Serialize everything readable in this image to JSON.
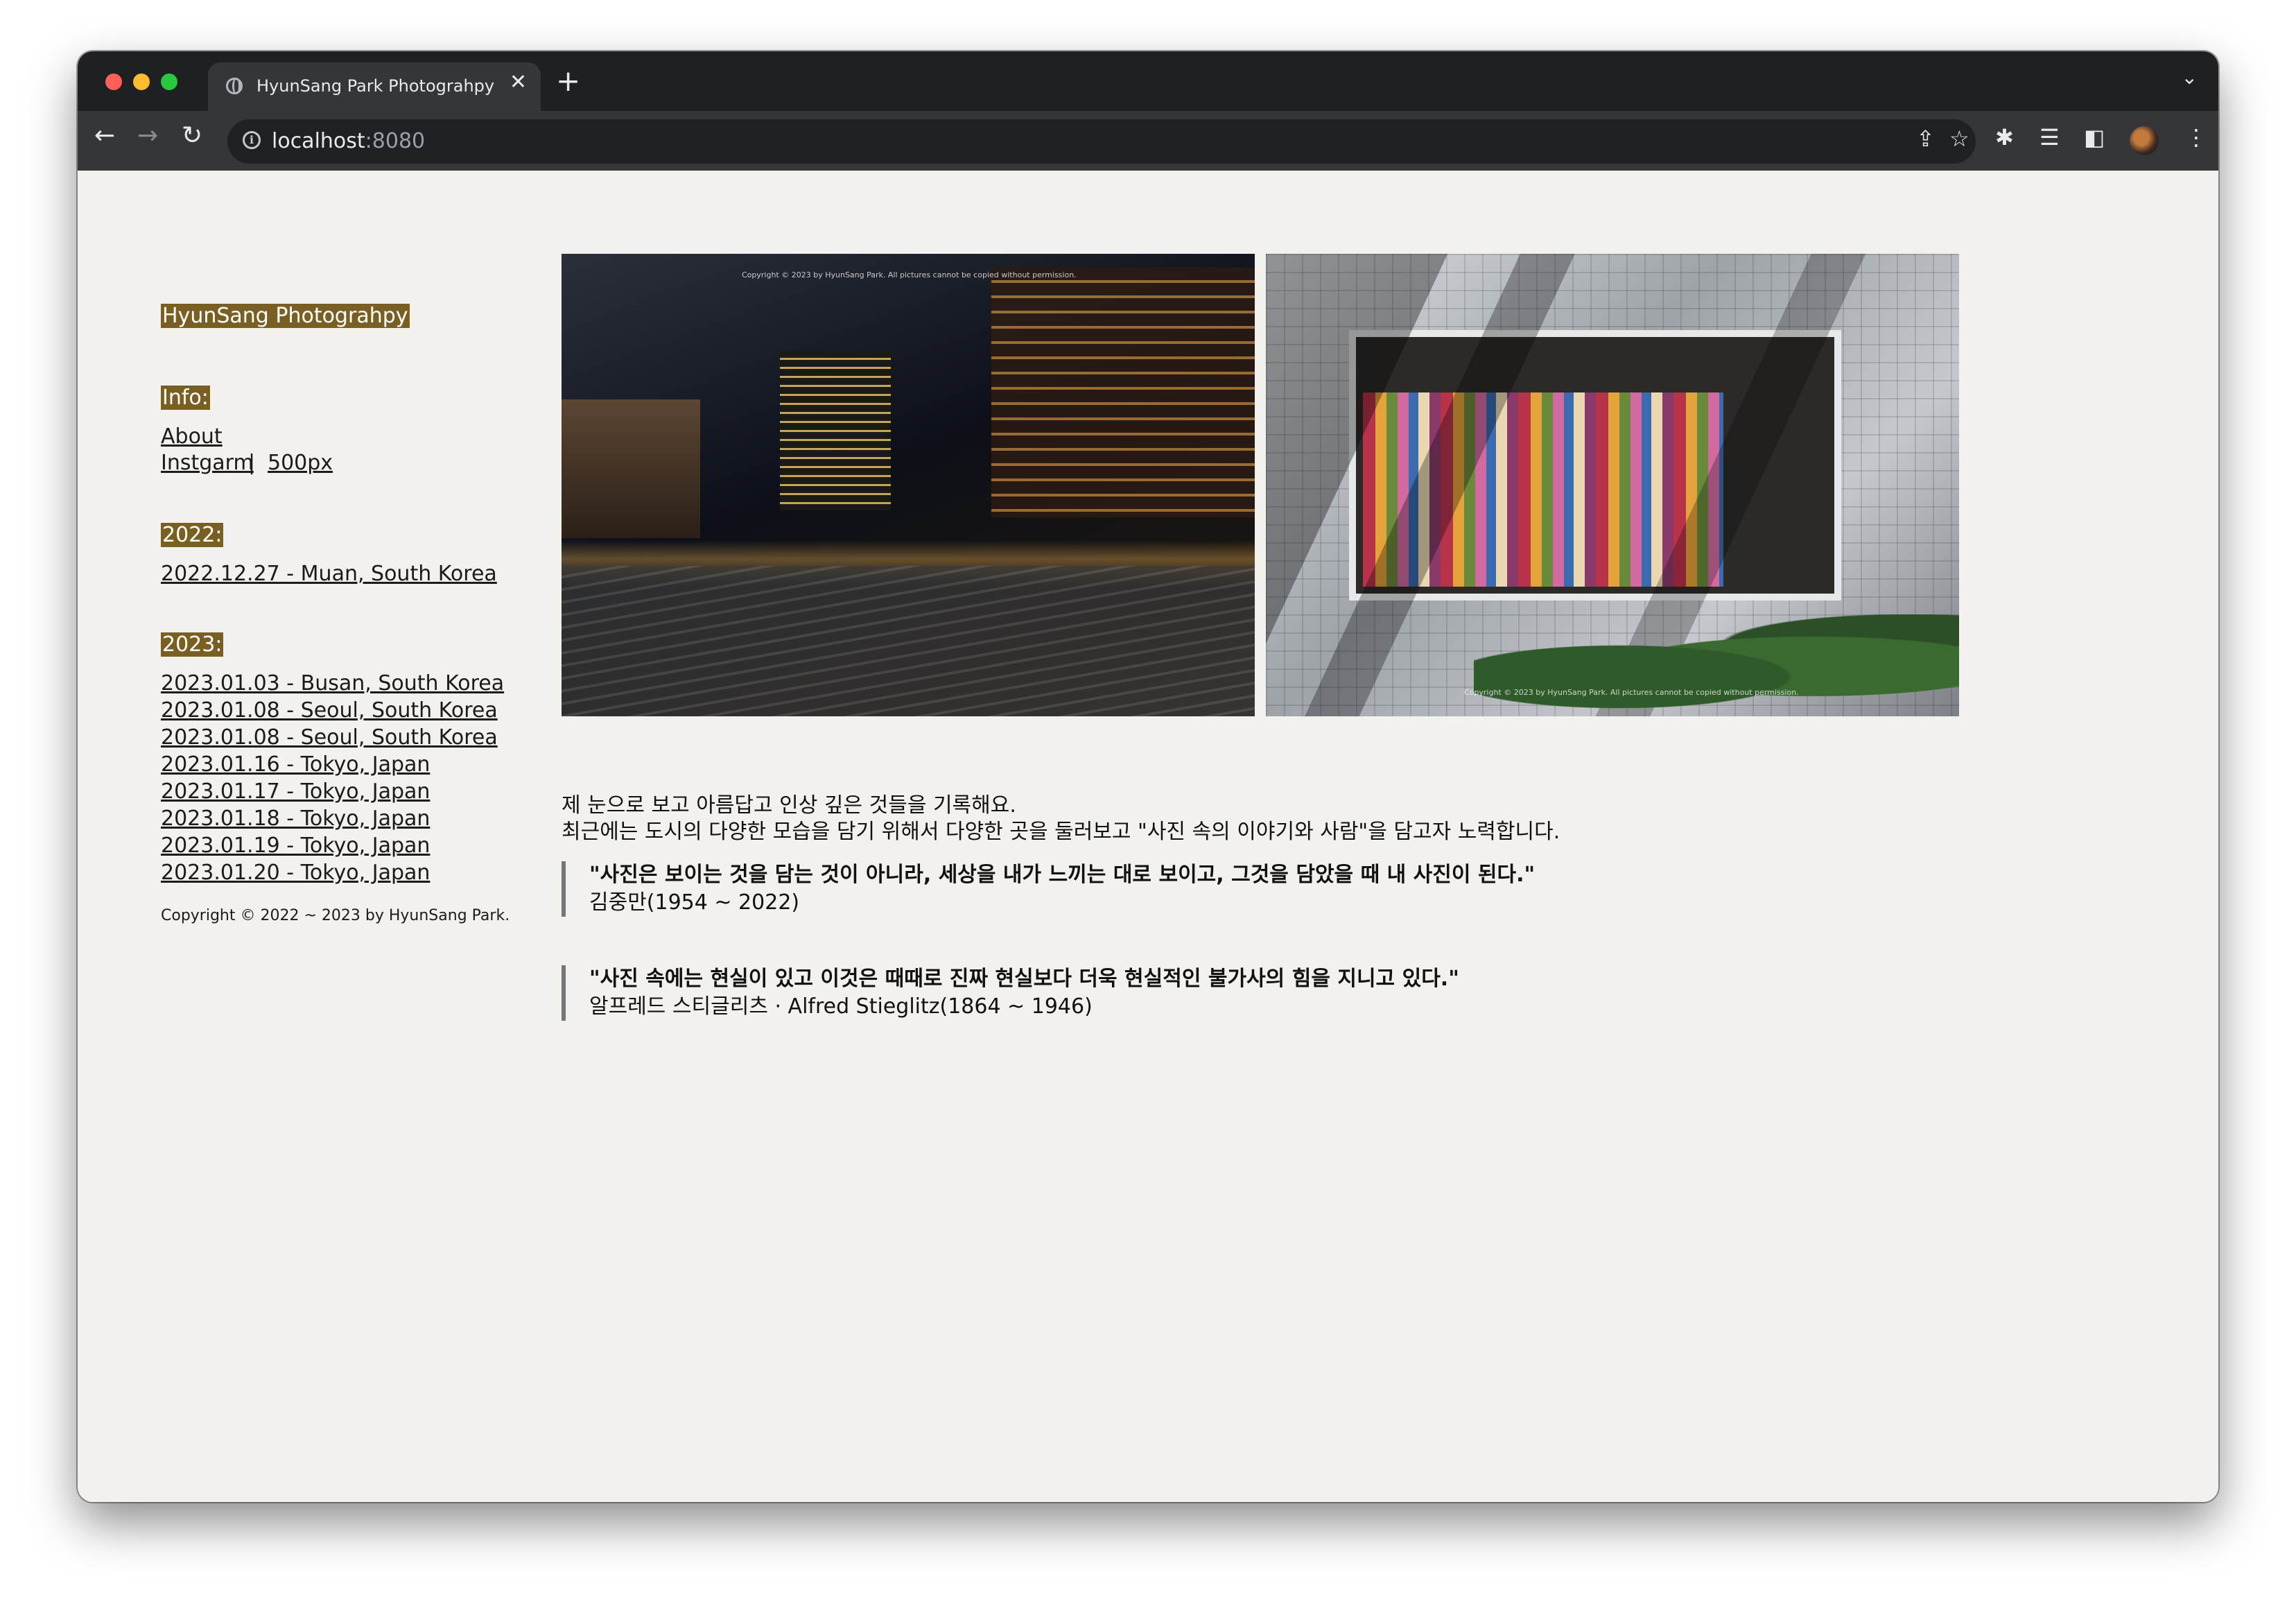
{
  "browser": {
    "tab_title": "HyunSang Park Photograhpy",
    "url_host": "localhost",
    "url_port": ":8080"
  },
  "sidebar": {
    "site_title": "HyunSang Photograhpy",
    "info_title": "Info:",
    "about_link": "About",
    "instagram_link": "Instgarm",
    "separator": "|",
    "px500_link": "500px",
    "year_2022_title": "2022:",
    "links_2022": [
      "2022.12.27 - Muan, South Korea"
    ],
    "year_2023_title": "2023:",
    "links_2023": [
      "2023.01.03 - Busan, South Korea",
      "2023.01.08 - Seoul, South Korea",
      "2023.01.08 - Seoul, South Korea",
      "2023.01.16 - Tokyo, Japan",
      "2023.01.17 - Tokyo, Japan",
      "2023.01.18 - Tokyo, Japan",
      "2023.01.19 - Tokyo, Japan",
      "2023.01.20 - Tokyo, Japan"
    ],
    "copyright": "Copyright © 2022 ~ 2023 by HyunSang Park."
  },
  "main": {
    "photo_caption_1": "Copyright © 2023 by HyunSang Park. All pictures cannot be copied without permission.",
    "photo_caption_2": "Copyright © 2023 by HyunSang Park. All pictures cannot be copied without permission.",
    "intro_line_1": "제 눈으로 보고 아름답고 인상 깊은 것들을 기록해요.",
    "intro_line_2": "최근에는 도시의 다양한 모습을 담기 위해서 다양한 곳을 둘러보고 \"사진 속의 이야기와 사람\"을 담고자 노력합니다.",
    "quotes": [
      {
        "text": "\"사진은 보이는 것을 담는 것이 아니라, 세상을 내가 느끼는 대로 보이고, 그것을 담았을 때 내 사진이 된다.\"",
        "author": "김중만(1954 ~ 2022)"
      },
      {
        "text": "\"사진 속에는 현실이 있고 이것은 때때로 진짜 현실보다 더욱 현실적인 불가사의 힘을 지니고 있다.\"",
        "author": "알프레드 스티글리츠 · Alfred Stieglitz(1864 ~ 1946)"
      }
    ]
  },
  "icons": {
    "back": "←",
    "forward": "→",
    "reload": "↻",
    "close": "✕",
    "new_tab": "+",
    "tab_menu": "⌄",
    "share": "⇪",
    "star": "☆",
    "extensions": "✱",
    "reading_list": "☰",
    "side_panel": "◧",
    "menu": "⋮",
    "info": "i"
  }
}
